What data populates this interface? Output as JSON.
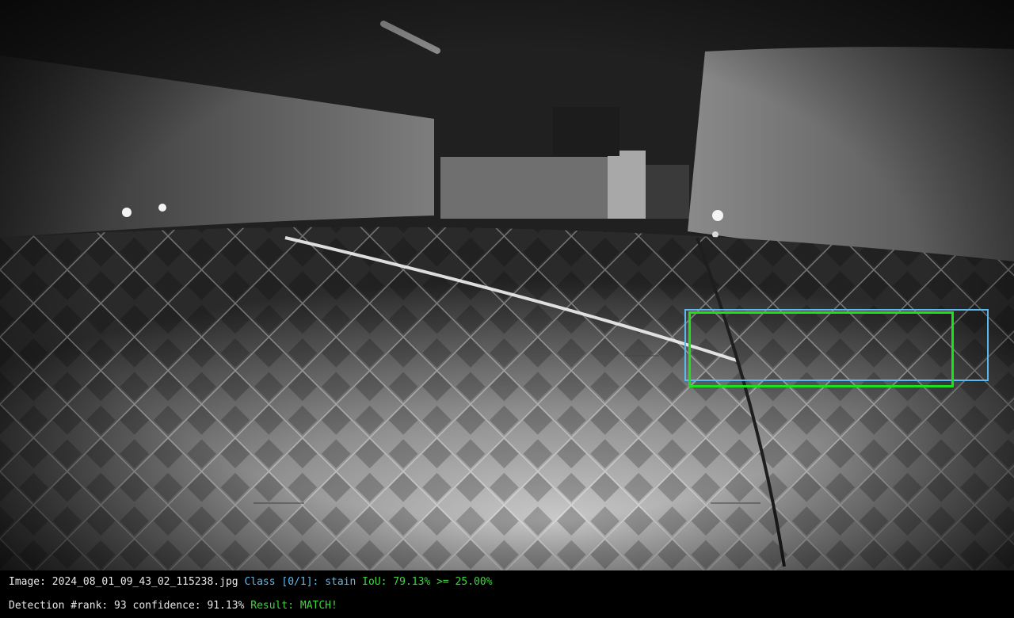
{
  "info": {
    "image_label": "Image:",
    "image_name": "2024_08_01_09_43_02_115238.jpg",
    "class_label": "Class [0/1]:",
    "class_name": "stain",
    "iou_text": "IoU: 79.13% >= 25.00%",
    "detection_text": "Detection #rank: 93 confidence: 91.13%",
    "result_text": "Result: MATCH!"
  },
  "colors": {
    "ground_truth_box": "#5cb8ef",
    "prediction_box": "#1ee11e",
    "status_text": "#e8e8e8",
    "class_text": "#5cb8ef",
    "match_text": "#3fd63f"
  }
}
